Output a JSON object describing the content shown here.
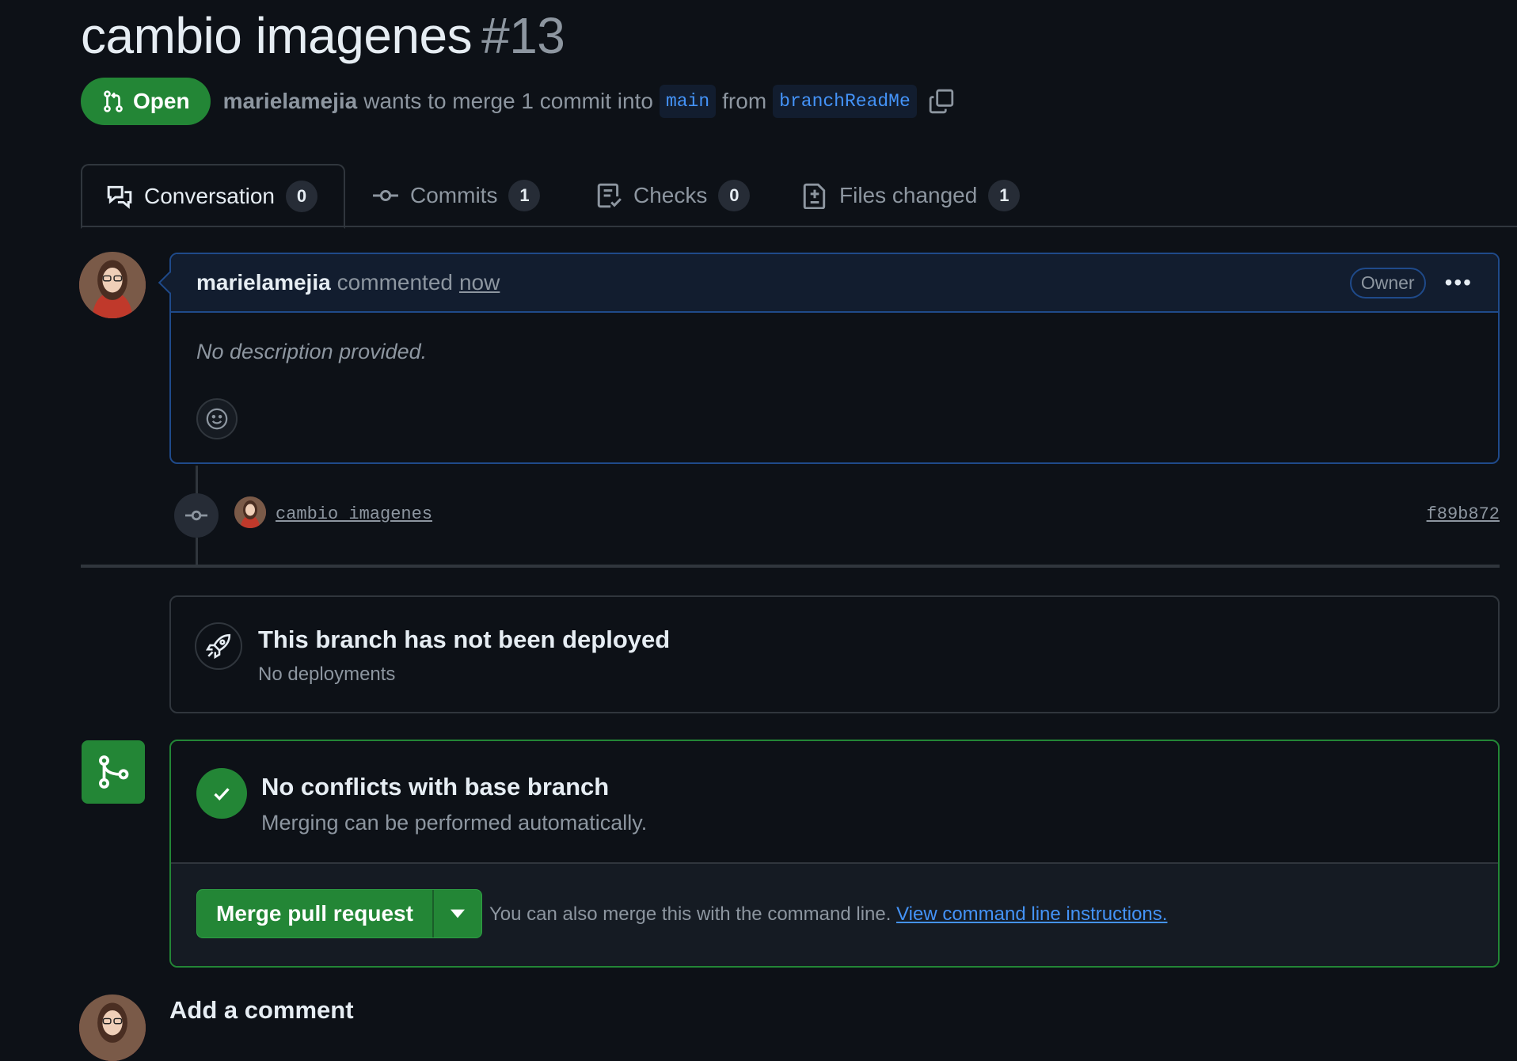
{
  "pr": {
    "title": "cambio imagenes",
    "number": "#13",
    "state_label": "Open",
    "author": "marielamejia",
    "merge_text": "wants to merge 1 commit into",
    "base_branch": "main",
    "from_text": "from",
    "head_branch": "branchReadMe",
    "icons": {
      "state": "git-pull-request-icon",
      "copy": "copy-icon"
    }
  },
  "tabs": [
    {
      "label": "Conversation",
      "count": "0",
      "icon": "comment-discussion-icon"
    },
    {
      "label": "Commits",
      "count": "1",
      "icon": "git-commit-icon"
    },
    {
      "label": "Checks",
      "count": "0",
      "icon": "checklist-icon"
    },
    {
      "label": "Files changed",
      "count": "1",
      "icon": "file-diff-icon"
    }
  ],
  "comment": {
    "author": "marielamejia",
    "action": "commented",
    "time": "now",
    "badge": "Owner",
    "menu": "•••",
    "body": "No description provided."
  },
  "commit": {
    "message": "cambio imagenes",
    "sha": "f89b872"
  },
  "deployment": {
    "title": "This branch has not been deployed",
    "subtitle": "No deployments"
  },
  "merge": {
    "title": "No conflicts with base branch",
    "subtitle": "Merging can be performed automatically.",
    "button_label": "Merge pull request",
    "hint_text": "You can also merge this with the command line.",
    "hint_link": "View command line instructions."
  },
  "add_comment": {
    "title": "Add a comment"
  },
  "colors": {
    "background": "#0d1117",
    "open_green": "#238636",
    "link_blue": "#4493f8",
    "muted": "#8d96a0",
    "border": "#30363d"
  }
}
